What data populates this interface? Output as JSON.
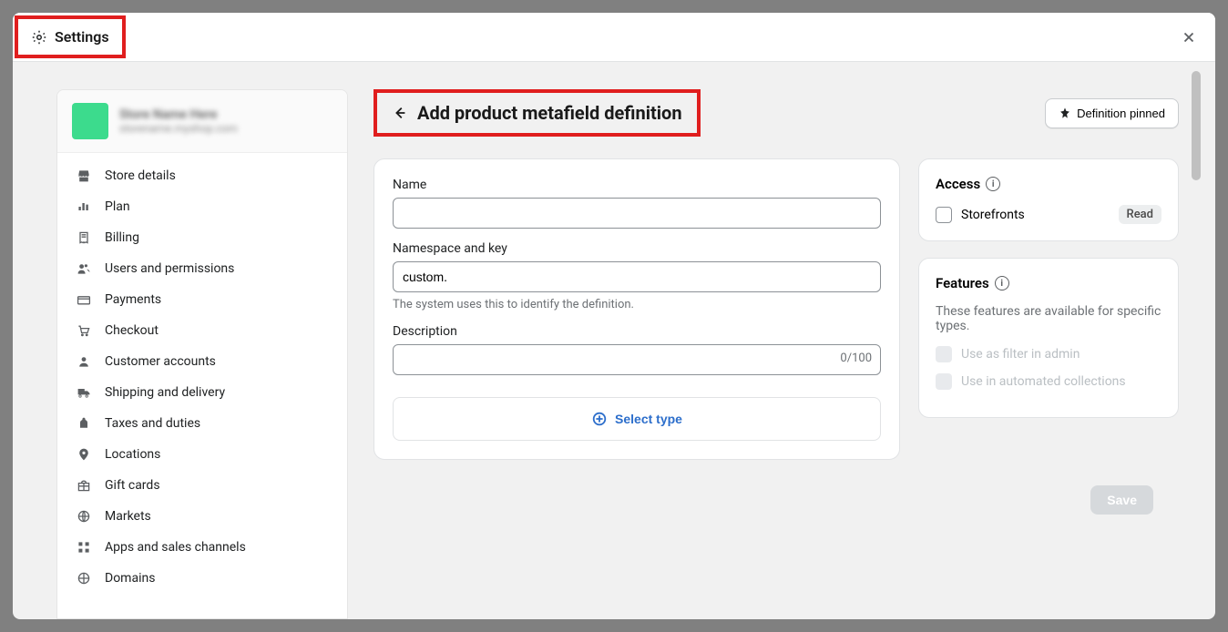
{
  "modal": {
    "title": "Settings"
  },
  "store": {
    "name_blur": "Store Name Here",
    "sub_blur": "storename.myshop.com"
  },
  "sidebar": {
    "items": [
      {
        "label": "Store details"
      },
      {
        "label": "Plan"
      },
      {
        "label": "Billing"
      },
      {
        "label": "Users and permissions"
      },
      {
        "label": "Payments"
      },
      {
        "label": "Checkout"
      },
      {
        "label": "Customer accounts"
      },
      {
        "label": "Shipping and delivery"
      },
      {
        "label": "Taxes and duties"
      },
      {
        "label": "Locations"
      },
      {
        "label": "Gift cards"
      },
      {
        "label": "Markets"
      },
      {
        "label": "Apps and sales channels"
      },
      {
        "label": "Domains"
      }
    ]
  },
  "page": {
    "title": "Add product metafield definition",
    "pinned_label": "Definition pinned"
  },
  "form": {
    "name_label": "Name",
    "name_value": "",
    "namespace_label": "Namespace and key",
    "namespace_value": "custom.",
    "namespace_helper": "The system uses this to identify the definition.",
    "description_label": "Description",
    "description_value": "",
    "description_count": "0/100",
    "select_type_label": "Select type"
  },
  "access": {
    "title": "Access",
    "storefronts_label": "Storefronts",
    "read_badge": "Read"
  },
  "features": {
    "title": "Features",
    "description": "These features are available for specific types.",
    "filter_label": "Use as filter in admin",
    "automated_label": "Use in automated collections"
  },
  "actions": {
    "save_label": "Save"
  }
}
